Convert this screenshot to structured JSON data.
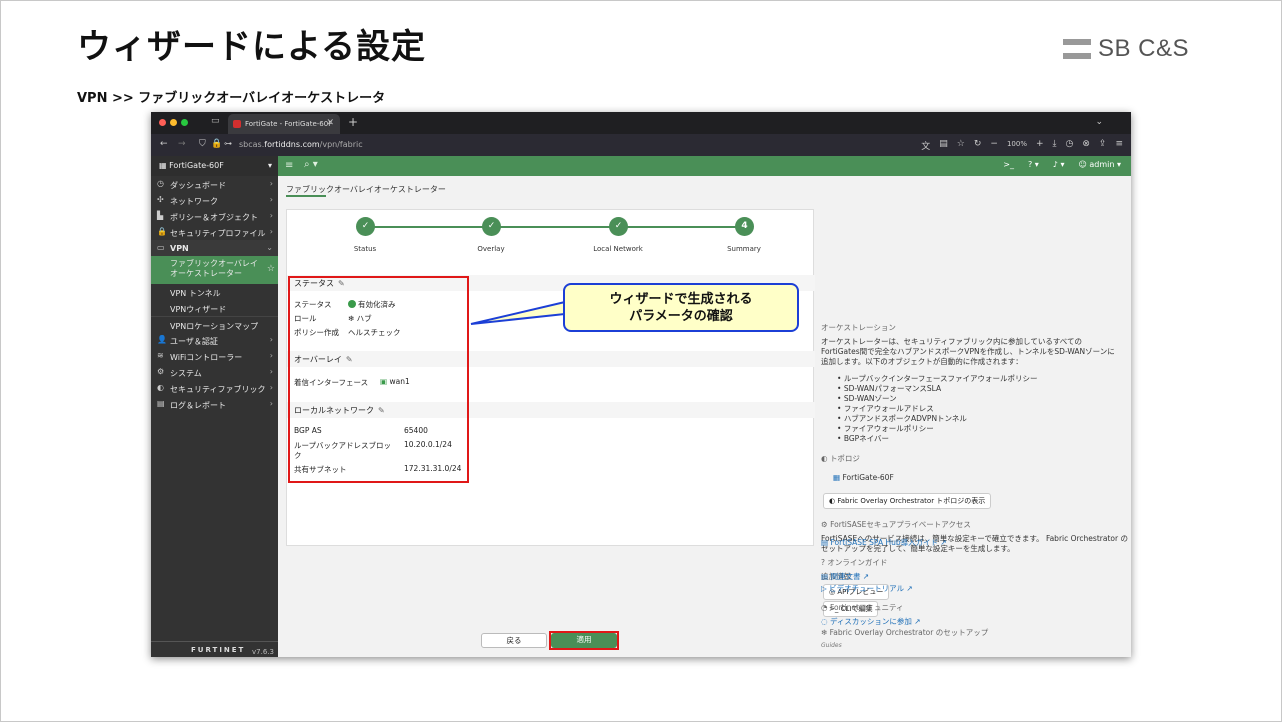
{
  "slide": {
    "title": "ウィザードによる設定",
    "logo": "SB C&S",
    "breadcrumb": "VPN >> ファブリックオーバレイオーケストレータ",
    "callout_line1": "ウィザードで生成される",
    "callout_line2": "パラメータの確認"
  },
  "browser": {
    "tab_title": "FortiGate - FortiGate-60F",
    "url_prefix": "sbcas.",
    "url_domain": "fortiddns.com",
    "url_path": "/vpn/fabric",
    "zoom": "100%"
  },
  "fg": {
    "device": "FortiGate-60F",
    "user": "admin",
    "version": "v7.6.3",
    "brand": "FURTINET"
  },
  "sidebar": {
    "items": [
      {
        "icon": "◷",
        "label": "ダッシュボード"
      },
      {
        "icon": "✣",
        "label": "ネットワーク"
      },
      {
        "icon": "▙",
        "label": "ポリシー＆オブジェクト"
      },
      {
        "icon": "🔒",
        "label": "セキュリティプロファイル"
      }
    ],
    "vpn_label": "VPN",
    "vpn_sub": [
      "ファブリックオーバレイ",
      "オーケストレーター",
      "VPN トンネル",
      "VPNウィザード",
      "VPNロケーションマップ"
    ],
    "items2": [
      {
        "icon": "👤",
        "label": "ユーザ＆認証"
      },
      {
        "icon": "≋",
        "label": "WiFiコントローラー"
      },
      {
        "icon": "⚙",
        "label": "システム"
      },
      {
        "icon": "◐",
        "label": "セキュリティファブリック"
      },
      {
        "icon": "▤",
        "label": "ログ＆レポート"
      }
    ]
  },
  "main": {
    "page_title": "ファブリックオーバレイオーケストレーター",
    "steps": [
      "Status",
      "Overlay",
      "Local Network",
      "Summary"
    ],
    "step4_num": "4",
    "status_section": "ステータス",
    "status_rows": [
      {
        "k": "ステータス",
        "v": "有効化済み"
      },
      {
        "k": "ロール",
        "v": "ハブ"
      },
      {
        "k": "ポリシー作成",
        "v": "ヘルスチェック"
      }
    ],
    "overlay_section": "オーバーレイ",
    "overlay_k": "着信インターフェース",
    "overlay_v": "wan1",
    "local_section": "ローカルネットワーク",
    "local_rows": [
      {
        "k": "BGP AS",
        "v": "65400"
      },
      {
        "k": "ループバックアドレスブロッ",
        "v": "10.20.0.1/24"
      },
      {
        "k": "ク",
        "v": ""
      },
      {
        "k": "共有サブネット",
        "v": "172.31.31.0/24"
      }
    ],
    "back_label": "戻る",
    "apply_label": "適用"
  },
  "right": {
    "orch_h": "オーケストレーション",
    "orch_p1": "オーケストレーターは、セキュリティファブリック内に参加しているすべての",
    "orch_p2": "FortiGates間で完全なハブアンドスポークVPNを作成し、トンネルをSD-WANゾーンに",
    "orch_p3": "追加します。以下のオブジェクトが自動的に作成されます：",
    "bullets": [
      "ループバックインターフェースファイアウォールポリシー",
      "SD-WANパフォーマンスSLA",
      "SD-WANゾーン",
      "ファイアウォールアドレス",
      "ハブアンドスポークADVPNトンネル",
      "ファイアウォールポリシー",
      "BGPネイバー"
    ],
    "topo_h": "トポロジ",
    "topo_device": "FortiGate-60F",
    "topo_btn": "Fabric Overlay Orchestrator トポロジの表示",
    "sase_h": "FortiSASEセキュアプライベートアクセス",
    "sase_p1": "FortiSASEへのサービス接続は、簡単な設定キーで確立できます。 Fabric Orchestrator の",
    "sase_p2": "セットアップを完了して、簡単な設定キーを生成します。",
    "add_h": "追加情報",
    "api_btn": "APIプレビュー",
    "cli_btn": "CLIで編集",
    "setup_h": "Fabric Overlay Orchestrator のセットアップ",
    "guides": "Guides",
    "guide_link": "FortiSASE SPA Hub導入ガイド",
    "online_h": "オンラインガイド",
    "doc_link": "関連文書",
    "video_link": "ビデオチュートリアル",
    "comm_h": "Fortinetコミュニティ",
    "disc_link": "ディスカッションに参加"
  }
}
